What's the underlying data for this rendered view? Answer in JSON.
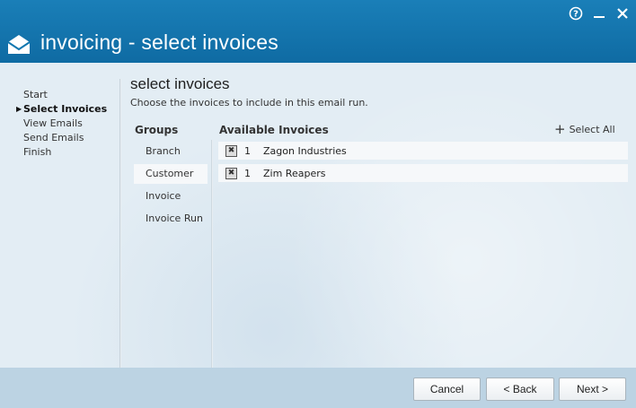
{
  "window": {
    "title": "invoicing - select invoices",
    "controls": {
      "help_icon": "?",
      "minimize_icon": "–",
      "close_icon": "✕"
    }
  },
  "wizard_steps": [
    {
      "label": "Start",
      "active": false
    },
    {
      "label": "Select Invoices",
      "active": true
    },
    {
      "label": "View Emails",
      "active": false
    },
    {
      "label": "Send Emails",
      "active": false
    },
    {
      "label": "Finish",
      "active": false
    }
  ],
  "page": {
    "title": "select invoices",
    "subtitle": "Choose the invoices to include in this email run."
  },
  "groups": {
    "header": "Groups",
    "items": [
      "Branch",
      "Customer",
      "Invoice",
      "Invoice Run"
    ],
    "selected": "Customer"
  },
  "invoices": {
    "header": "Available Invoices",
    "select_all": "Select All",
    "rows": [
      {
        "checked": true,
        "count": "1",
        "name": "Zagon Industries"
      },
      {
        "checked": true,
        "count": "1",
        "name": "Zim Reapers"
      }
    ]
  },
  "footer": {
    "cancel": "Cancel",
    "back": "< Back",
    "next": "Next >"
  },
  "colors": {
    "titlebar": "#1177b0",
    "content_bg": "#e3edf4",
    "footer_bg": "#bcd3e3"
  }
}
